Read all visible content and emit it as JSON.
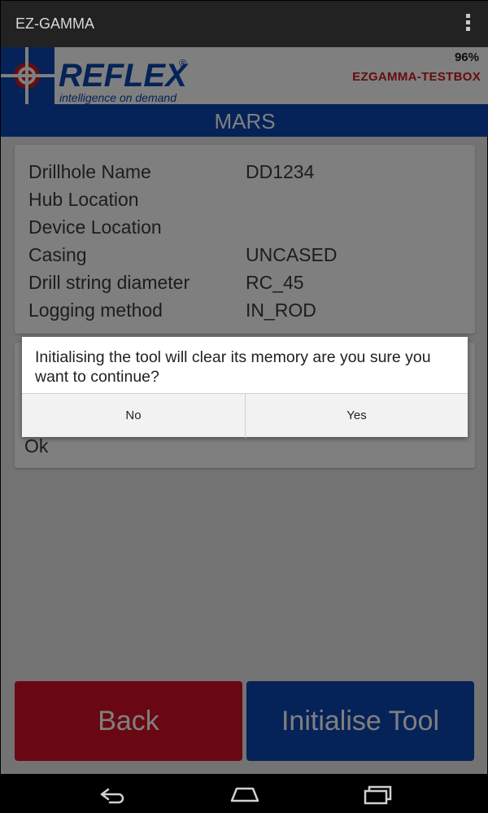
{
  "app": {
    "title": "EZ-GAMMA"
  },
  "header": {
    "battery": "96%",
    "device_name": "EZGAMMA-TESTBOX",
    "logo_text": "REFLEX",
    "logo_tagline": "intelligence on demand",
    "logo_mark": "®"
  },
  "page": {
    "title": "MARS"
  },
  "info": {
    "rows": [
      {
        "label": "Drillhole Name",
        "value": "DD1234"
      },
      {
        "label": "Hub Location",
        "value": ""
      },
      {
        "label": "Device Location",
        "value": ""
      },
      {
        "label": "Casing",
        "value": "UNCASED"
      },
      {
        "label": "Drill string diameter",
        "value": "RC_45"
      },
      {
        "label": "Logging method",
        "value": "IN_ROD"
      }
    ]
  },
  "status": {
    "text": "Ok"
  },
  "buttons": {
    "back": "Back",
    "initialise": "Initialise Tool"
  },
  "dialog": {
    "message": "Initialising the tool will clear its memory are you sure you want to continue?",
    "no": "No",
    "yes": "Yes"
  },
  "colors": {
    "brand_blue": "#0a46b0",
    "brand_red": "#d21126",
    "device_name_red": "#cc1a1a"
  },
  "icons": {
    "overflow": "overflow-menu-icon",
    "nav_back": "nav-back-icon",
    "nav_home": "nav-home-icon",
    "nav_recents": "nav-recents-icon"
  }
}
